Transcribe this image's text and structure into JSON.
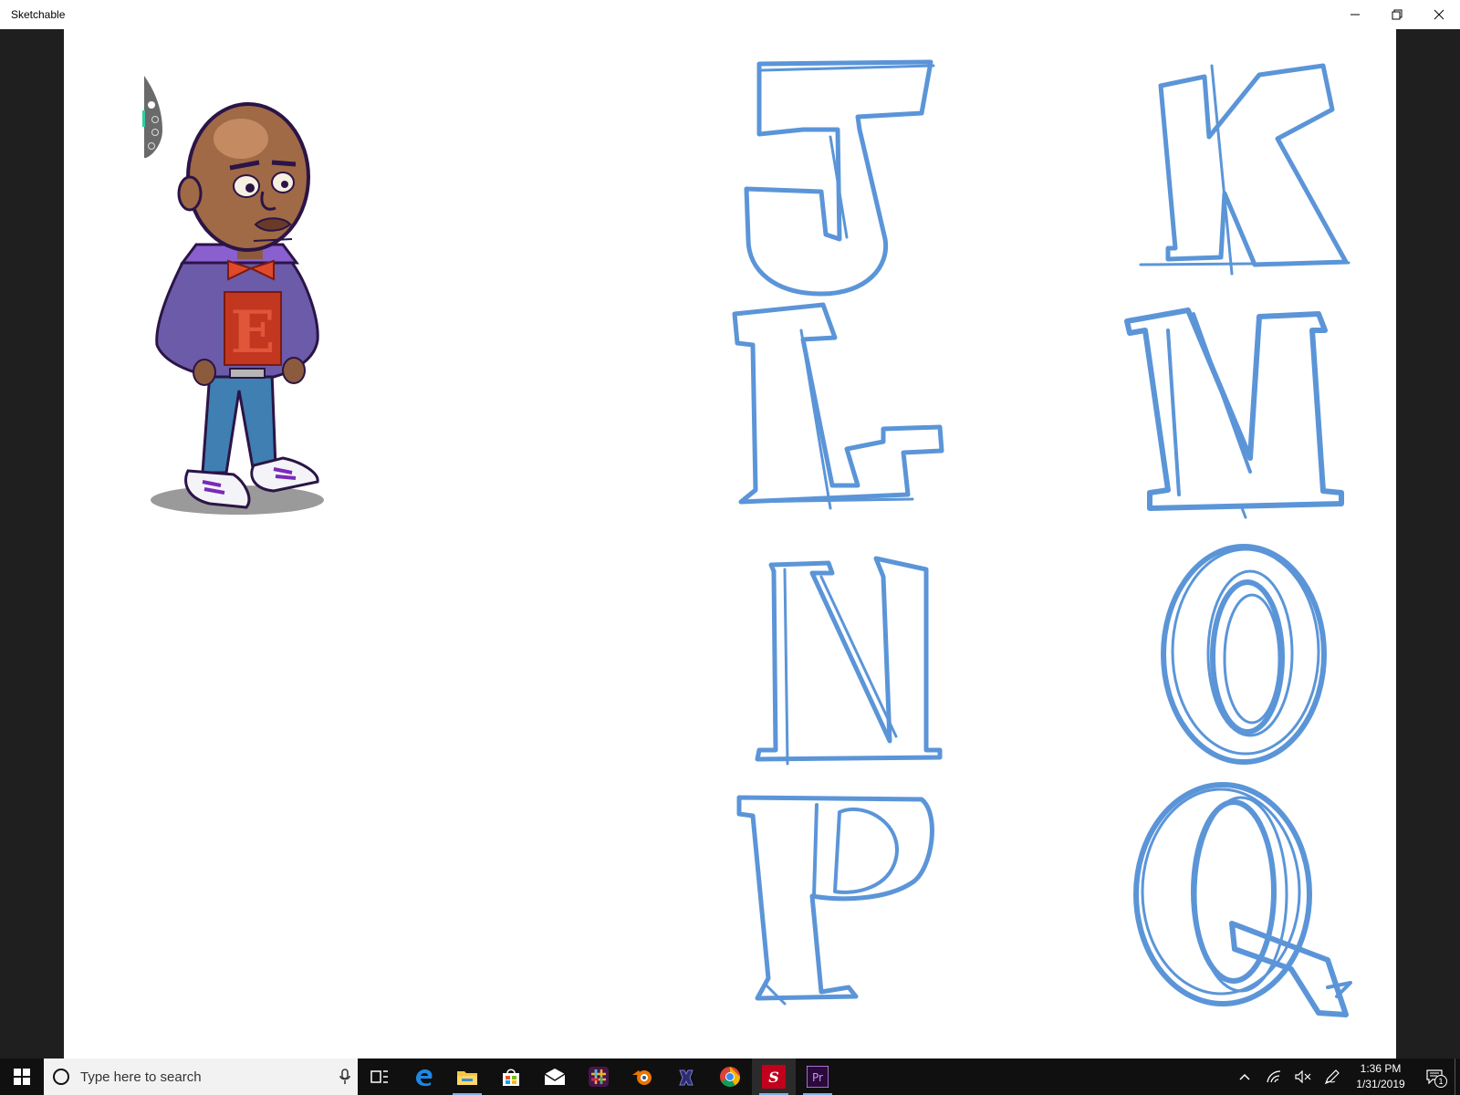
{
  "window": {
    "title": "Sketchable",
    "controls": [
      "minimize-icon",
      "restore-icon",
      "close-icon"
    ]
  },
  "canvas": {
    "background": "#ffffff",
    "stroke_color": "#5b95d8",
    "letters": [
      "J",
      "K",
      "L",
      "M",
      "N",
      "O",
      "P",
      "Q"
    ],
    "character_emblem": "E",
    "pen_tools": [
      "pen-icon",
      "brush-icon",
      "touch-icon",
      "eraser-icon"
    ]
  },
  "taskbar": {
    "search_placeholder": "Type here to search",
    "apps": [
      {
        "name": "task-view-icon"
      },
      {
        "name": "edge-icon"
      },
      {
        "name": "file-explorer-icon"
      },
      {
        "name": "store-icon"
      },
      {
        "name": "mail-icon"
      },
      {
        "name": "slack-icon"
      },
      {
        "name": "blender-icon"
      },
      {
        "name": "app-icon"
      },
      {
        "name": "chrome-icon"
      },
      {
        "name": "sketchable-icon"
      },
      {
        "name": "premiere-icon"
      }
    ],
    "clock": {
      "time": "1:36 PM",
      "date": "1/31/2019"
    },
    "notification_count": "1",
    "premiere_label": "Pr",
    "sketchable_label": "S"
  },
  "colors": {
    "taskbar": "#101010",
    "accent": "#7fb0e8"
  }
}
